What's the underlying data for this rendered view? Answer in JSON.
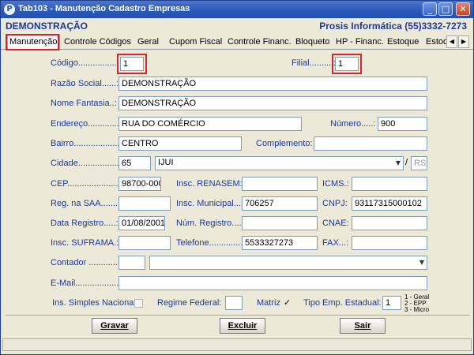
{
  "window": {
    "title": "Tab103 - Manutenção Cadastro Empresas",
    "app_icon": "P",
    "minimize": "_",
    "maximize": "□",
    "close": "✕"
  },
  "header": {
    "company": "DEMONSTRAÇÃO",
    "vendor": "Prosis Informática (55)3332-7273"
  },
  "tabs": [
    {
      "label": "Manutenção"
    },
    {
      "label": "Controle Códigos"
    },
    {
      "label": "Geral"
    },
    {
      "label": "Cupom Fiscal"
    },
    {
      "label": "Controle Financ."
    },
    {
      "label": "Bloqueto"
    },
    {
      "label": "HP - Financ."
    },
    {
      "label": "Estoque"
    },
    {
      "label": "Estoq"
    }
  ],
  "tab_scroll": {
    "left": "◀",
    "right": "▶"
  },
  "form": {
    "codigo": {
      "label": "Código.................:",
      "value": "1"
    },
    "filial": {
      "label": "Filial..........:",
      "value": "1"
    },
    "razao_social": {
      "label": "Razão Social......:",
      "value": "DEMONSTRAÇÃO"
    },
    "nome_fantasia": {
      "label": "Nome Fantasia..:",
      "value": "DEMONSTRAÇÃO"
    },
    "endereco": {
      "label": "Endereço.............:",
      "value": "RUA DO COMÉRCIO"
    },
    "numero": {
      "label": "Número.....:",
      "value": "900"
    },
    "bairro": {
      "label": "Bairro......................:",
      "value": "CENTRO"
    },
    "complemento": {
      "label": "Complemento:",
      "value": ""
    },
    "cidade": {
      "label": "Cidade..................:",
      "code": "65",
      "name": "IJUI",
      "uf_sep": "/",
      "uf": "RS"
    },
    "cep": {
      "label": "CEP.........................:",
      "value": "98700-000"
    },
    "insc_renasem": {
      "label": "Insc. RENASEM:",
      "value": ""
    },
    "icms": {
      "label": "ICMS.:",
      "value": ""
    },
    "reg_saa": {
      "label": "Reg. na SAA.......:",
      "value": ""
    },
    "insc_municipal": {
      "label": "Insc. Municipal...:",
      "value": "706257"
    },
    "cnpj": {
      "label": "CNPJ:",
      "value": "93117315000102"
    },
    "data_registro": {
      "label": "Data Registro.....:",
      "value": "01/08/2001"
    },
    "num_registro": {
      "label": "Núm. Registro....:",
      "value": ""
    },
    "cnae": {
      "label": "CNAE:",
      "value": ""
    },
    "insc_suframa": {
      "label": "Insc. SUFRAMA.:",
      "value": ""
    },
    "telefone": {
      "label": "Telefone...............:",
      "value": "5533327273"
    },
    "fax": {
      "label": "FAX...:",
      "value": ""
    },
    "contador": {
      "label": "Contador ..............:",
      "code": "",
      "name": ""
    },
    "email": {
      "label": "E-Mail.....................:",
      "value": ""
    },
    "simples_nacional": {
      "label": "Ins. Simples Nacional",
      "checked": false
    },
    "regime_federal": {
      "label": "Regime Federal:",
      "value": ""
    },
    "matriz": {
      "label": "Matriz",
      "checked": true,
      "mark": "✓"
    },
    "tipo_emp_estadual": {
      "label": "Tipo Emp. Estadual:",
      "value": "1"
    },
    "tipo_legend": [
      "1 - Geral",
      "2 - EPP",
      "3 - Micro"
    ]
  },
  "buttons": {
    "gravar": "Gravar",
    "excluir": "Excluir",
    "sair": "Sair"
  },
  "icons": {
    "dropdown_arrow": "▼"
  },
  "colors": {
    "title_bar": "#2a58b8",
    "label_text": "#1a3a9a",
    "highlight_box": "#d7252b",
    "window_bg": "#ece9d8"
  }
}
